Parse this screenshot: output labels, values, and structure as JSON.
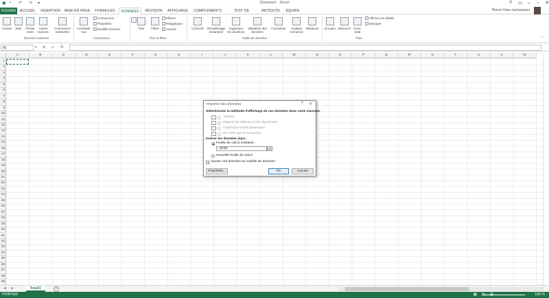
{
  "window": {
    "title": "Classeur1 - Excel"
  },
  "quick_access": {
    "icons": [
      "excel-logo",
      "save",
      "undo",
      "redo",
      "customize"
    ]
  },
  "tabs": [
    {
      "label": "FICHIER"
    },
    {
      "label": "ACCUEIL"
    },
    {
      "label": "INSERTION"
    },
    {
      "label": "MISE EN PAGE"
    },
    {
      "label": "FORMULES"
    },
    {
      "label": "DONNÉES"
    },
    {
      "label": "RÉVISION"
    },
    {
      "label": "AFFICHAGE"
    },
    {
      "label": "COMPLÉMENTS"
    },
    {
      "label": "TEST DE CHARGE"
    },
    {
      "label": "ANTIDOTE"
    },
    {
      "label": "ÉQUIPE"
    }
  ],
  "active_tab": "DONNÉES",
  "user": {
    "name": "Pierre-Yves Lamoureux"
  },
  "ribbon": {
    "group_external": {
      "label": "Données externes",
      "buttons": [
        {
          "l1": "Access",
          "l2": ""
        },
        {
          "l1": "Web",
          "l2": ""
        },
        {
          "l1": "Fichier",
          "l2": "texte"
        },
        {
          "l1": "Autres",
          "l2": "sources"
        }
      ],
      "connections_btn": {
        "l1": "Connexions",
        "l2": "existantes"
      }
    },
    "group_connections": {
      "label": "Connexions",
      "refresh": {
        "l1": "Actualiser",
        "l2": "tout"
      },
      "small": [
        "Connexions",
        "Propriétés",
        "Modifier les liens"
      ]
    },
    "group_sort": {
      "label": "Trier et filtrer",
      "sort": "Trier",
      "filter": "Filtrer",
      "small": [
        "Effacer",
        "Réappliquer",
        "Avancé"
      ]
    },
    "group_tools": {
      "label": "Outils de données",
      "buttons": [
        {
          "l1": "Convertir",
          "l2": ""
        },
        {
          "l1": "Remplissage",
          "l2": "instantané"
        },
        {
          "l1": "Supprimer",
          "l2": "les doublons"
        },
        {
          "l1": "Validation des",
          "l2": "données"
        },
        {
          "l1": "Consolider",
          "l2": ""
        },
        {
          "l1": "Analyse",
          "l2": "scénarios"
        },
        {
          "l1": "Relations",
          "l2": ""
        }
      ]
    },
    "group_outline": {
      "label": "Plan",
      "buttons": [
        {
          "l1": "Grouper",
          "l2": ""
        },
        {
          "l1": "Dissocier",
          "l2": ""
        },
        {
          "l1": "Sous-",
          "l2": "total"
        }
      ],
      "small": [
        "Afficher les détails",
        "Masquer"
      ]
    }
  },
  "formula_bar": {
    "name_box": "A1",
    "formula": "",
    "fx_label": "fx"
  },
  "grid": {
    "columns": [
      "A",
      "B",
      "C",
      "D",
      "E",
      "F",
      "G",
      "H",
      "I",
      "J",
      "K",
      "L",
      "M",
      "N",
      "O",
      "P",
      "Q",
      "R",
      "S",
      "T",
      "U",
      "V",
      "W"
    ],
    "rows": [
      "1",
      "2",
      "3",
      "4",
      "5",
      "6",
      "7",
      "8",
      "9",
      "10",
      "11",
      "12",
      "13",
      "14",
      "15",
      "16",
      "17",
      "18",
      "19",
      "20",
      "21",
      "22",
      "23",
      "24",
      "25",
      "26",
      "27",
      "28",
      "29",
      "30",
      "31",
      "32",
      "33",
      "34",
      "35",
      "36",
      "37",
      "38",
      "39"
    ]
  },
  "sheets": [
    {
      "label": "Feuil1"
    }
  ],
  "status": {
    "mode": "POINTER",
    "zoom": "100 %"
  },
  "dialog": {
    "title": "Importer des données",
    "help": "?",
    "close": "✕",
    "heading": "Sélectionnez la méthode d'affichage de ces données dans votre classeur.",
    "options": [
      {
        "label": "Tableau",
        "selected": false
      },
      {
        "label": "Rapport de tableau croisé dynamique",
        "selected": false
      },
      {
        "label": "Graphique croisé dynamique",
        "selected": false
      },
      {
        "label": "Ne créer que la connexion",
        "selected": false
      }
    ],
    "insert_heading": "Insérer les données dans :",
    "sheet_options": [
      {
        "label": "Feuille de calcul existante :",
        "selected": true
      },
      {
        "label": "Nouvelle feuille de calcul",
        "selected": false
      }
    ],
    "reference": "=$A$1",
    "add_model": {
      "label": "Ajouter ces données au modèle de données",
      "checked": false
    },
    "buttons": {
      "properties": "Propriétés...",
      "ok": "OK",
      "cancel": "Annuler"
    }
  },
  "colors": {
    "accent": "#217346",
    "dialog_default_border": "#3c7fb1"
  }
}
